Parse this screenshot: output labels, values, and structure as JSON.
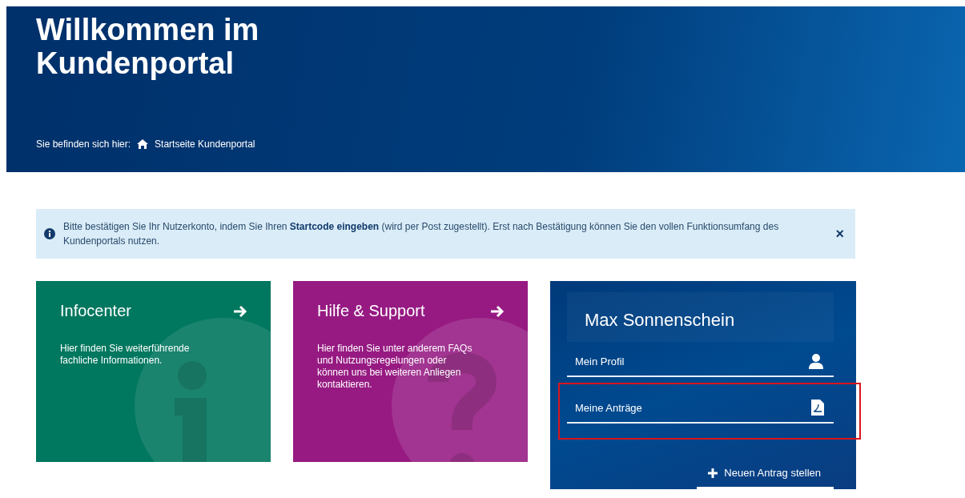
{
  "header": {
    "title": "Willkommen im Kundenportal",
    "breadcrumb_label": "Sie befinden sich hier:",
    "breadcrumb_link": "Startseite Kundenportal"
  },
  "alert": {
    "text": "Bitte bestätigen Sie Ihr Nutzerkonto, indem Sie Ihren **Startcode eingeben** (wird per Post zugestellt). Erst nach Bestätigung können Sie den vollen Funktionsumfang des Kundenportals nutzen.",
    "close": "×"
  },
  "tiles": [
    {
      "kind": "info",
      "title": "Infocenter",
      "text": "Hier finden Sie weiterführende fachliche Informationen.",
      "color": "#00775f"
    },
    {
      "kind": "help",
      "title": "Hilfe & Support",
      "text": "Hier finden Sie unter anderem FAQs und Nutzungsregelungen oder können uns bei weiteren Anliegen kontaktieren.",
      "color": "#961a82"
    }
  ],
  "account": {
    "name": "Max Sonnenschein",
    "links": [
      {
        "kind": "profile",
        "label": "Mein Profil",
        "highlighted": false
      },
      {
        "kind": "applications",
        "label": "Meine Anträge",
        "highlighted": true
      }
    ],
    "action": "Neuen Antrag stellen"
  }
}
